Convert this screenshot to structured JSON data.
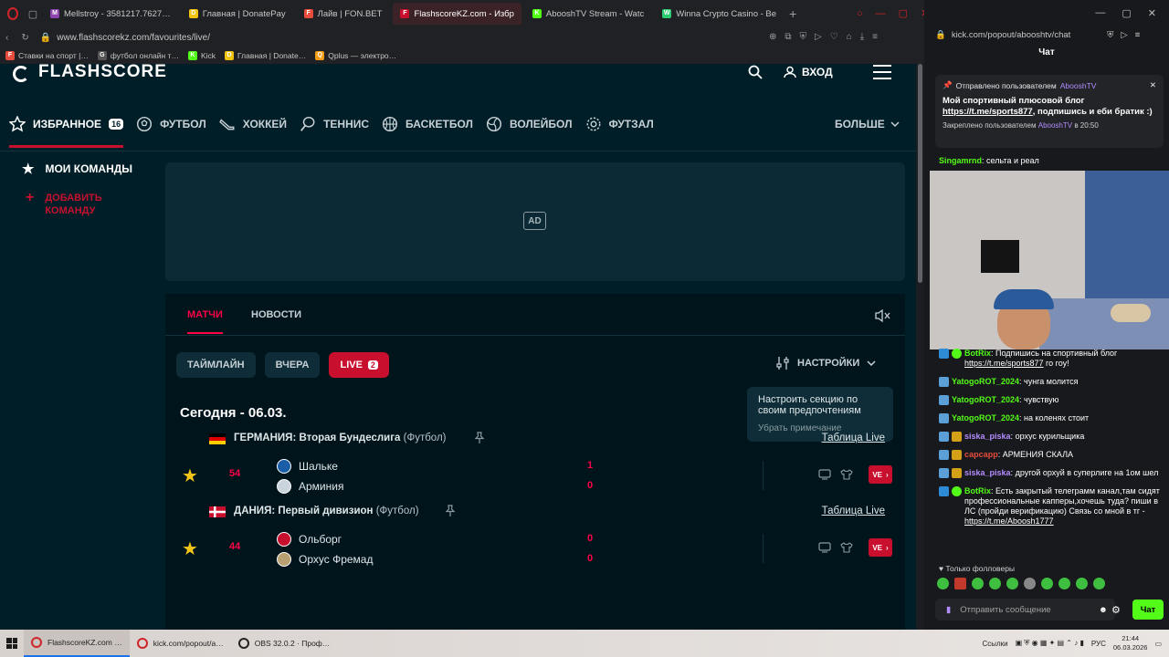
{
  "browser": {
    "tabs": [
      {
        "title": "Mellstroy - 3581217.7627…",
        "fav_color": "#8e44ad",
        "fav": "M",
        "active": false
      },
      {
        "title": "Главная | DonatePay",
        "fav_color": "#f1c40f",
        "fav": "D",
        "active": false
      },
      {
        "title": "Лайв | FON.BET",
        "fav_color": "#e74c3c",
        "fav": "F",
        "active": false
      },
      {
        "title": "FlashscoreKZ.com - Избр",
        "fav_color": "#c8102e",
        "fav": "F",
        "active": true
      },
      {
        "title": "AbooshTV Stream - Watc",
        "fav_color": "#53fc18",
        "fav": "K",
        "active": false
      },
      {
        "title": "Winna Crypto Casino - Be",
        "fav_color": "#2ecc71",
        "fav": "W",
        "active": false
      }
    ],
    "url": "www.flashscorekz.com/favourites/live/",
    "bookmarks": [
      {
        "label": "Ставки на спорт |…",
        "color": "#e74c3c",
        "fav": "F"
      },
      {
        "label": "футбол онлайн т…",
        "color": "#555555",
        "fav": "G"
      },
      {
        "label": "Kick",
        "color": "#53fc18",
        "fav": "K"
      },
      {
        "label": "Главная | Donate…",
        "color": "#f1c40f",
        "fav": "D"
      },
      {
        "label": "Qplus — электро…",
        "color": "#f39c12",
        "fav": "Q"
      }
    ]
  },
  "flashscore": {
    "logo": "FLASHSCORE",
    "login": "ВХОД",
    "nav": [
      {
        "label": "ИЗБРАННОЕ",
        "count": "16",
        "icon": "star-icon"
      },
      {
        "label": "ФУТБОЛ",
        "icon": "football-icon"
      },
      {
        "label": "ХОККЕЙ",
        "icon": "hockey-icon"
      },
      {
        "label": "ТЕННИС",
        "icon": "tennis-icon"
      },
      {
        "label": "БАСКЕТБОЛ",
        "icon": "basketball-icon"
      },
      {
        "label": "ВОЛЕЙБОЛ",
        "icon": "volleyball-icon"
      },
      {
        "label": "ФУТЗАЛ",
        "icon": "futsal-icon"
      }
    ],
    "more": "БОЛЬШЕ",
    "sidebar": {
      "my_teams": "МОИ КОМАНДЫ",
      "add_team": "ДОБАВИТЬ КОМАНДУ"
    },
    "ad_label": "AD",
    "tabs": {
      "matches": "МАТЧИ",
      "news": "НОВОСТИ"
    },
    "filters": {
      "timeline": "ТАЙМЛАЙН",
      "yesterday": "ВЧЕРА",
      "live": "LIVE",
      "live_count": "2"
    },
    "settings": "НАСТРОЙКИ",
    "tooltip": {
      "title": "Настроить секцию по своим предпочтениям",
      "dismiss": "Убрать примечание"
    },
    "date": "Сегодня - 06.03.",
    "standings_label": "Таблица Live",
    "live_btn": "VE",
    "leagues": [
      {
        "country": "ГЕРМАНИЯ",
        "name": "Вторая Бундеслига",
        "sport": "(Футбол)",
        "flag": "germany",
        "match": {
          "minute": "54",
          "home": "Шальке",
          "away": "Арминия",
          "home_score": "1",
          "away_score": "0"
        }
      },
      {
        "country": "ДАНИЯ",
        "name": "Первый дивизион",
        "sport": "(Футбол)",
        "flag": "denmark",
        "match": {
          "minute": "44",
          "home": "Ольборг",
          "away": "Орхус Фремад",
          "home_score": "0",
          "away_score": "0"
        }
      }
    ]
  },
  "kick": {
    "url": "kick.com/popout/abooshtv/chat",
    "title": "Чат",
    "pinned": {
      "sent_by": "Отправлено пользователем",
      "sender": "AbooshTV",
      "text": "Мой спортивный плюсовой блог",
      "link": "https://t.me/sports877",
      "text2": ", подпишись и еби братик :)",
      "pinned_by": "Закреплено пользователем",
      "pinner": "AbooshTV",
      "pinned_time": "в 20:50"
    },
    "first": {
      "user": "Singamrnd",
      "text": "сельта и реал"
    },
    "messages": [
      {
        "user": "BotRix",
        "color": "#53fc18",
        "badges": [
          "bot",
          "check"
        ],
        "text": "Подпишись на спортивный блог ",
        "link": "https://t.me/sports877",
        "after": " го гоу!"
      },
      {
        "user": "YatogoROT_2024",
        "color": "#53fc18",
        "badges": [
          "sub"
        ],
        "text": "чунга молится"
      },
      {
        "user": "YatogoROT_2024",
        "color": "#53fc18",
        "badges": [
          "sub"
        ],
        "text": "чувствую"
      },
      {
        "user": "YatogoROT_2024",
        "color": "#53fc18",
        "badges": [
          "sub"
        ],
        "text": "на коленях стоит"
      },
      {
        "user": "siska_piska",
        "color": "#b38cff",
        "badges": [
          "sub",
          "gold"
        ],
        "text": "орхус курильщика"
      },
      {
        "user": "сарсарр",
        "color": "#e74c3c",
        "badges": [
          "sub",
          "gold"
        ],
        "text": "АРМЕНИЯ СКАЛА"
      },
      {
        "user": "siska_piska",
        "color": "#b38cff",
        "badges": [
          "sub",
          "gold"
        ],
        "text": "другой орхуй в суперлиге на 1ом шел"
      },
      {
        "user": "BotRix",
        "color": "#53fc18",
        "badges": [
          "bot",
          "check"
        ],
        "text": "Есть закрытый телеграмм канал,там сидят профессиональные капперы,хочешь туда? пиши в ЛС (пройди верификацию) Связь со мной в тг - ",
        "link": "https://t.me/Aboosh1777",
        "after": ""
      }
    ],
    "followers_only": "Только фолловеры",
    "input_placeholder": "Отправить сообщение",
    "send": "Чат"
  },
  "taskbar": {
    "items": [
      "FlashscoreKZ.com …",
      "kick.com/popout/a…",
      "OBS 32.0.2 · Проф…"
    ],
    "tray_label": "Ссылки",
    "lang": "РУС",
    "time": "21:44",
    "date": "06.03.2026"
  }
}
